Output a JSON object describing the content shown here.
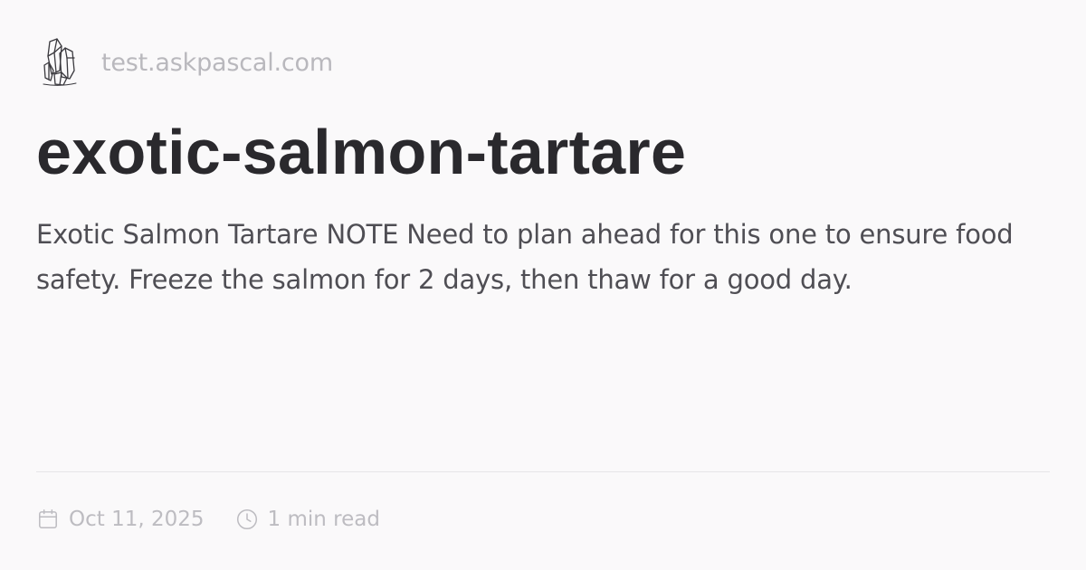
{
  "site": {
    "logo_icon": "crystal-icon",
    "domain": "test.askpascal.com"
  },
  "page": {
    "title": "exotic-salmon-tartare",
    "description": "Exotic Salmon Tartare NOTE Need to plan ahead for this one to ensure food safety. Freeze the salmon for 2 days, then thaw for a good day."
  },
  "meta": {
    "date_icon": "calendar-icon",
    "date": "Oct 11, 2025",
    "read_time_icon": "clock-icon",
    "read_time": "1 min read"
  },
  "colors": {
    "background": "#faf9fa",
    "title": "#2a292d",
    "description": "#4f4e54",
    "muted": "#bdbcc1",
    "divider": "#e6e5e8"
  }
}
